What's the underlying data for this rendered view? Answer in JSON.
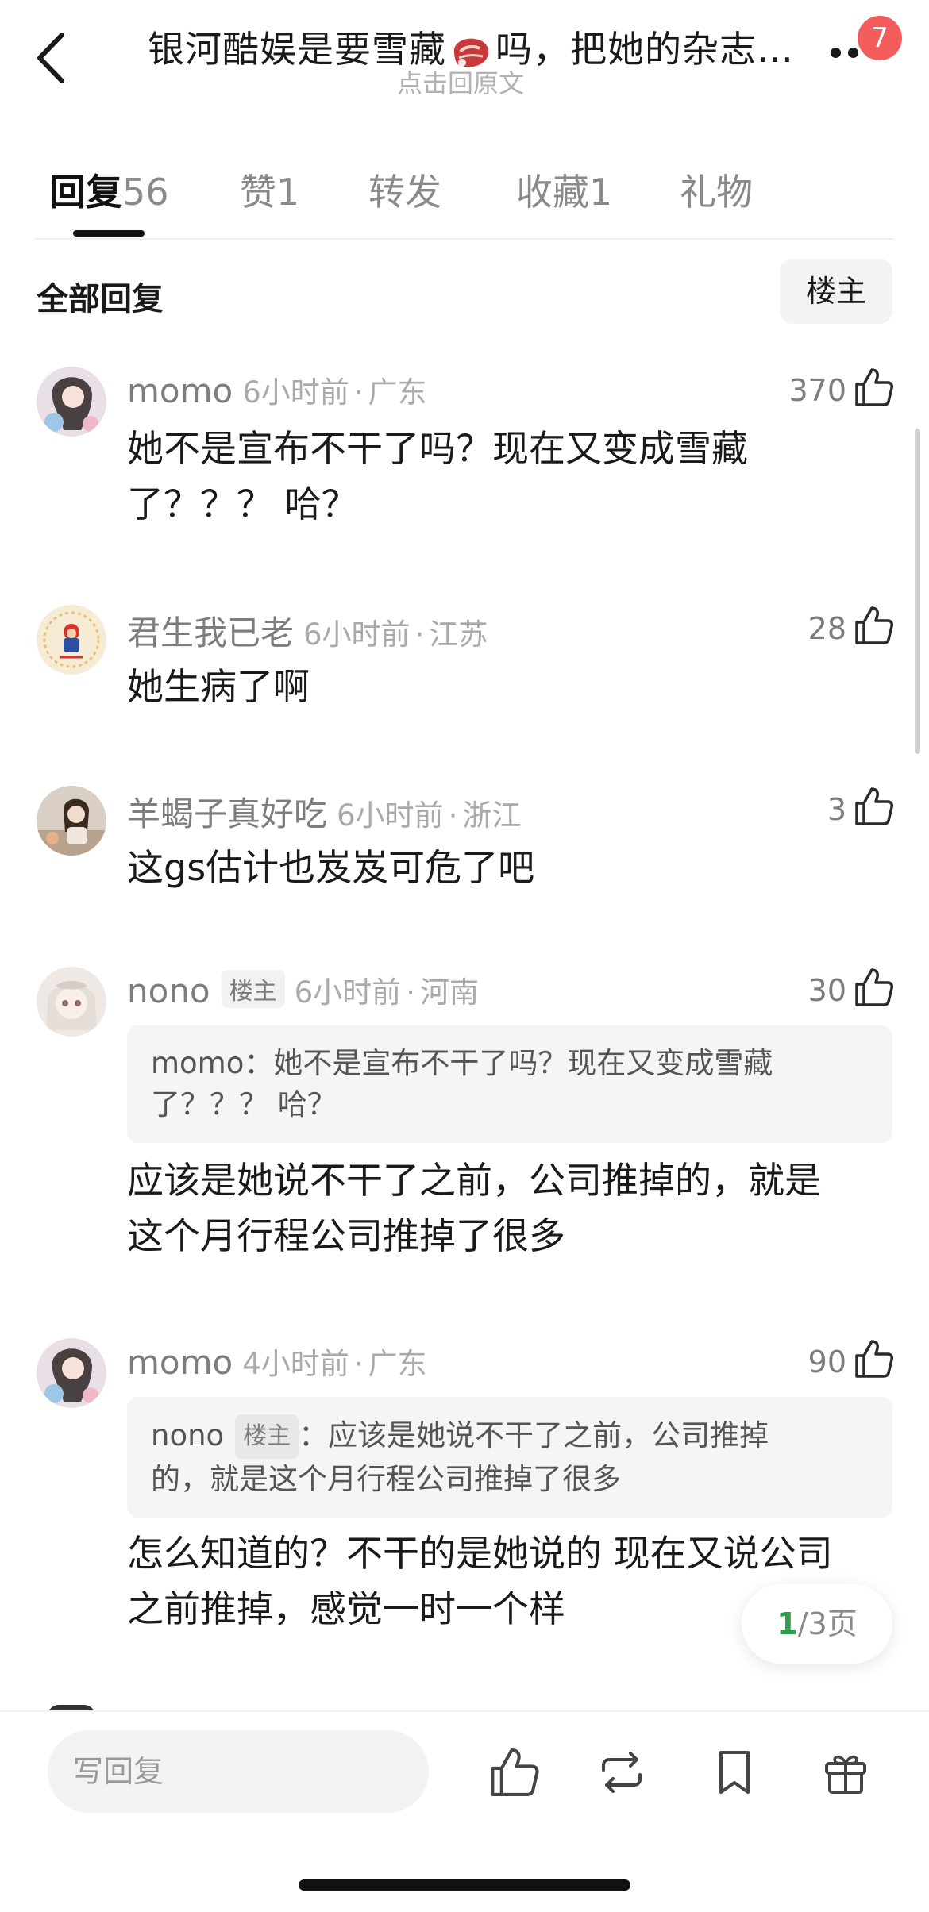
{
  "header": {
    "title_part1": "银河酷娱是要雪藏",
    "title_part2": "吗，把她的杂志…",
    "subtitle": "点击回原文",
    "notification_count": "7"
  },
  "tabs": [
    {
      "label": "回复",
      "count": "56",
      "active": true
    },
    {
      "label": "赞",
      "count": "1"
    },
    {
      "label": "转发",
      "count": ""
    },
    {
      "label": "收藏",
      "count": "1"
    },
    {
      "label": "礼物",
      "count": ""
    }
  ],
  "filter": {
    "all_replies": "全部回复",
    "op_only": "楼主"
  },
  "comments": [
    {
      "name": "momo",
      "time": "6小时前",
      "location": "广东",
      "likes": "370",
      "text_lines": [
        "她不是宣布不干了吗？现在又变成雪藏",
        "了？？？ 哈？"
      ]
    },
    {
      "name": "君生我已老",
      "time": "6小时前",
      "location": "江苏",
      "likes": "28",
      "text_lines": [
        "她生病了啊"
      ]
    },
    {
      "name": "羊蝎子真好吃",
      "time": "6小时前",
      "location": "浙江",
      "likes": "3",
      "text_lines": [
        "这gs估计也岌岌可危了吧"
      ]
    },
    {
      "name": "nono",
      "is_op": true,
      "op_tag": "楼主",
      "time": "6小时前",
      "location": "河南",
      "likes": "30",
      "quote": {
        "author": "momo",
        "lines": [
          "momo：她不是宣布不干了吗？现在又变成雪藏",
          "了？？？ 哈？"
        ]
      },
      "text_lines": [
        "应该是她说不干了之前，公司推掉的，就是",
        "这个月行程公司推掉了很多"
      ]
    },
    {
      "name": "momo",
      "time": "4小时前",
      "location": "广东",
      "likes": "90",
      "quote": {
        "author": "nono",
        "op_tag": "楼主",
        "line1_rest": "：应该是她说不干了之前，公司推掉",
        "line2": "的，就是这个月行程公司推掉了很多"
      },
      "text_lines": [
        "怎么知道的？不干的是她说的 现在又说公司",
        "之前推掉，感觉一时一个样"
      ]
    }
  ],
  "pager": {
    "current": "1",
    "total_text": "/3页"
  },
  "bottom_bar": {
    "reply_placeholder": "写回复"
  },
  "colors": {
    "accent_green": "#2e9e4a",
    "badge_red": "#f25c5c",
    "meta_gray": "#aaaaaa"
  }
}
